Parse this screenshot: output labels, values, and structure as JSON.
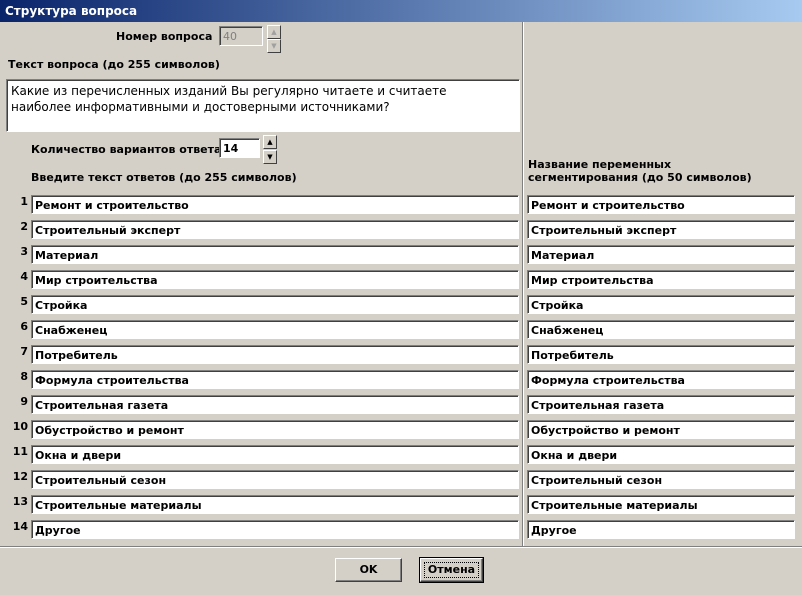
{
  "window": {
    "title": "Структура вопроса"
  },
  "question": {
    "number_label": "Номер вопроса",
    "number_value": "40",
    "text_label": "Текст вопроса (до 255 символов)",
    "text_value": "Какие из перечисленных изданий Вы регулярно читаете и считаете\nнаиболее информативными и достоверными источниками?"
  },
  "answers": {
    "count_label": "Количество вариантов ответа",
    "count_value": "14",
    "enter_label": "Введите текст ответов (до 255 символов)",
    "segment_label_line1": "Название переменных",
    "segment_label_line2": "сегментирования (до 50 символов)",
    "items": [
      {
        "n": "1",
        "text": "Ремонт и строительство",
        "seg": "Ремонт и строительство"
      },
      {
        "n": "2",
        "text": "Строительный эксперт",
        "seg": "Строительный эксперт"
      },
      {
        "n": "3",
        "text": "Материал",
        "seg": "Материал"
      },
      {
        "n": "4",
        "text": "Мир строительства",
        "seg": "Мир строительства"
      },
      {
        "n": "5",
        "text": "Стройка",
        "seg": "Стройка"
      },
      {
        "n": "6",
        "text": "Снабженец",
        "seg": "Снабженец"
      },
      {
        "n": "7",
        "text": "Потребитель",
        "seg": "Потребитель"
      },
      {
        "n": "8",
        "text": "Формула строительства",
        "seg": "Формула строительства"
      },
      {
        "n": "9",
        "text": "Строительная газета",
        "seg": "Строительная газета"
      },
      {
        "n": "10",
        "text": "Обустройство и ремонт",
        "seg": "Обустройство и ремонт"
      },
      {
        "n": "11",
        "text": "Окна и двери",
        "seg": "Окна и двери"
      },
      {
        "n": "12",
        "text": "Строительный сезон",
        "seg": "Строительный сезон"
      },
      {
        "n": "13",
        "text": "Строительные материалы",
        "seg": "Строительные материалы"
      },
      {
        "n": "14",
        "text": "Другое",
        "seg": "Другое"
      }
    ]
  },
  "buttons": {
    "ok": "OK",
    "cancel": "Отмена"
  },
  "icons": {
    "spin_up": "spin-up-arrow-icon",
    "spin_down": "spin-down-arrow-icon"
  }
}
